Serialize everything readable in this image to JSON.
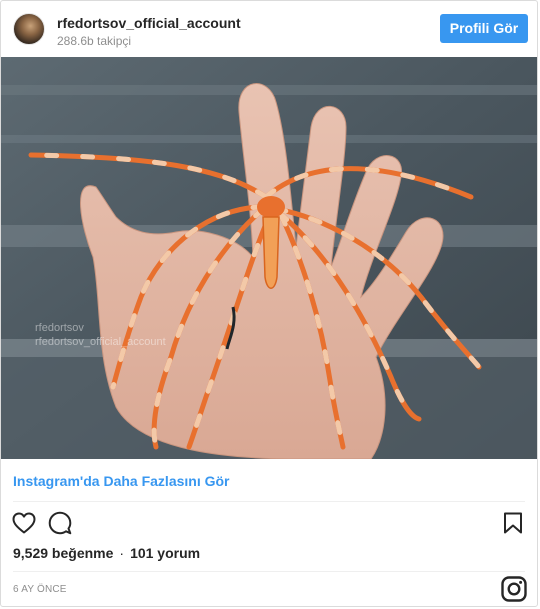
{
  "header": {
    "username": "rfedortsov_official_account",
    "followers": "288.6b takipçi",
    "profile_button_label": "Profili Gör",
    "avatar_icon": "user-avatar"
  },
  "media": {
    "watermark_line1": "rfedortsov",
    "watermark_line2": "rfedortsov_official_account"
  },
  "more_link": "Instagram'da Daha Fazlasını Gör",
  "actions": {
    "like_icon": "heart-icon",
    "comment_icon": "comment-icon",
    "save_icon": "bookmark-icon"
  },
  "stats": {
    "likes": "9,529 beğenme",
    "separator": "·",
    "comments": "101 yorum"
  },
  "timestamp": "6 AY ÖNCE",
  "footer": {
    "logo_icon": "instagram-icon"
  },
  "colors": {
    "accent": "#3897f0",
    "text": "#262626",
    "muted": "#8e8e8e",
    "border": "#dbdbdb"
  }
}
